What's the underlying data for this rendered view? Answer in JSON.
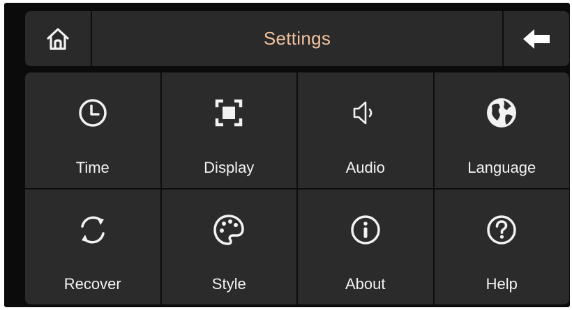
{
  "header": {
    "title": "Settings",
    "home_icon": "home-icon",
    "back_icon": "back-arrow-icon"
  },
  "tiles": [
    {
      "label": "Time",
      "icon": "clock-icon"
    },
    {
      "label": "Display",
      "icon": "display-frame-icon"
    },
    {
      "label": "Audio",
      "icon": "speaker-icon"
    },
    {
      "label": "Language",
      "icon": "globe-icon"
    },
    {
      "label": "Recover",
      "icon": "recover-arrows-icon"
    },
    {
      "label": "Style",
      "icon": "palette-icon"
    },
    {
      "label": "About",
      "icon": "info-icon"
    },
    {
      "label": "Help",
      "icon": "help-icon"
    }
  ],
  "colors": {
    "title": "#f3c3a0",
    "tile_bg": "#2b2b2b",
    "frame": "#0b0b0b",
    "text": "#f2f2f2"
  }
}
